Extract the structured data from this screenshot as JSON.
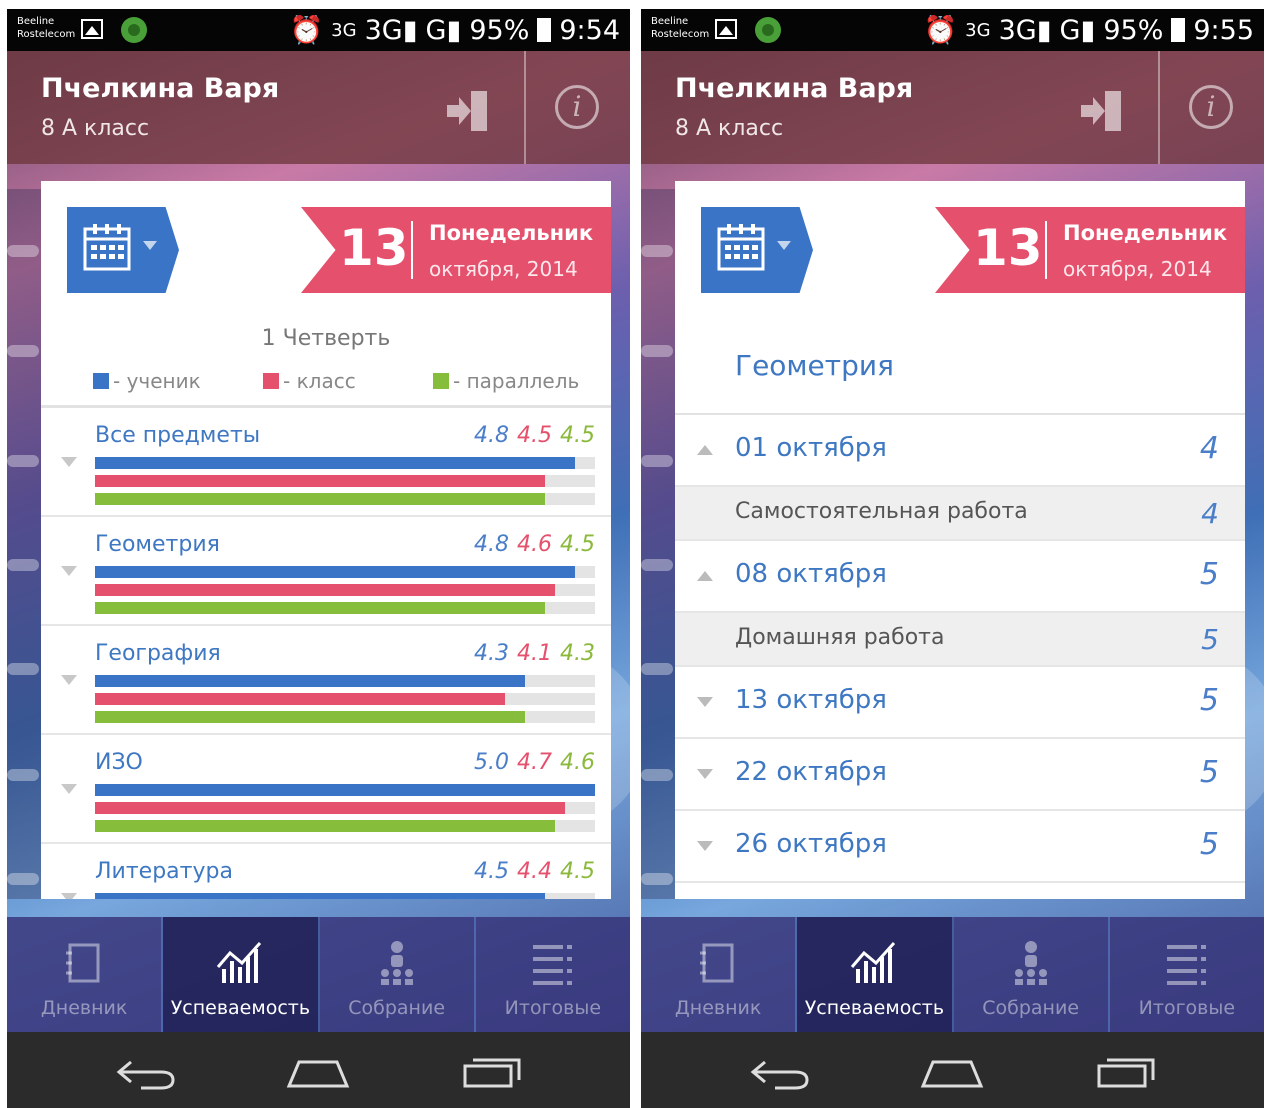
{
  "left": {
    "status": {
      "carrier1": "Beeline",
      "carrier2": "Rostelecom",
      "net3g": "3G",
      "net_label": "3G",
      "gsm_label": "G",
      "battery": "95%",
      "time": "9:54"
    },
    "header": {
      "student": "Пчелкина Варя",
      "class": "8 А класс"
    },
    "date": {
      "day": "13",
      "weekday": "Понедельник",
      "month_year": "октября, 2014"
    },
    "quarter": "1 Четверть",
    "legend": {
      "student": "- ученик",
      "class": "- класс",
      "parallel": "- параллель"
    },
    "subjects": [
      {
        "name": "Все предметы",
        "student": "4.8",
        "class": "4.5",
        "parallel": "4.5"
      },
      {
        "name": "Геометрия",
        "student": "4.8",
        "class": "4.6",
        "parallel": "4.5"
      },
      {
        "name": "География",
        "student": "4.3",
        "class": "4.1",
        "parallel": "4.3"
      },
      {
        "name": "ИЗО",
        "student": "5.0",
        "class": "4.7",
        "parallel": "4.6"
      },
      {
        "name": "Литература",
        "student": "4.5",
        "class": "4.4",
        "parallel": "4.5"
      }
    ],
    "tabs": [
      "Дневник",
      "Успеваемость",
      "Собрание",
      "Итоговые"
    ]
  },
  "right": {
    "status": {
      "carrier1": "Beeline",
      "carrier2": "Rostelecom",
      "net3g": "3G",
      "net_label": "3G",
      "gsm_label": "G",
      "battery": "95%",
      "time": "9:55"
    },
    "header": {
      "student": "Пчелкина Варя",
      "class": "8 А класс"
    },
    "date": {
      "day": "13",
      "weekday": "Понедельник",
      "month_year": "октября, 2014"
    },
    "subject_title": "Геометрия",
    "rows": [
      {
        "kind": "date",
        "label": "01 октября",
        "grade": "4",
        "expanded": true
      },
      {
        "kind": "work",
        "label": "Самостоятельная работа",
        "grade": "4"
      },
      {
        "kind": "date",
        "label": "08 октября",
        "grade": "5",
        "expanded": true
      },
      {
        "kind": "work",
        "label": "Домашняя работа",
        "grade": "5"
      },
      {
        "kind": "date",
        "label": "13 октября",
        "grade": "5",
        "expanded": false
      },
      {
        "kind": "date",
        "label": "22 октября",
        "grade": "5",
        "expanded": false
      },
      {
        "kind": "date",
        "label": "26 октября",
        "grade": "5",
        "expanded": false
      }
    ],
    "tabs": [
      "Дневник",
      "Успеваемость",
      "Собрание",
      "Итоговые"
    ]
  },
  "active_tab": "Успеваемость",
  "max_grade": 5,
  "colors": {
    "student": "#3a74c6",
    "class": "#e5516d",
    "parallel": "#86bd3a",
    "accent": "#e5516d"
  },
  "icons": [
    "exit-icon",
    "info-icon",
    "calendar-icon",
    "diary-icon",
    "progress-chart-icon",
    "meeting-icon",
    "final-grades-icon",
    "back-icon",
    "home-icon",
    "recents-icon"
  ]
}
